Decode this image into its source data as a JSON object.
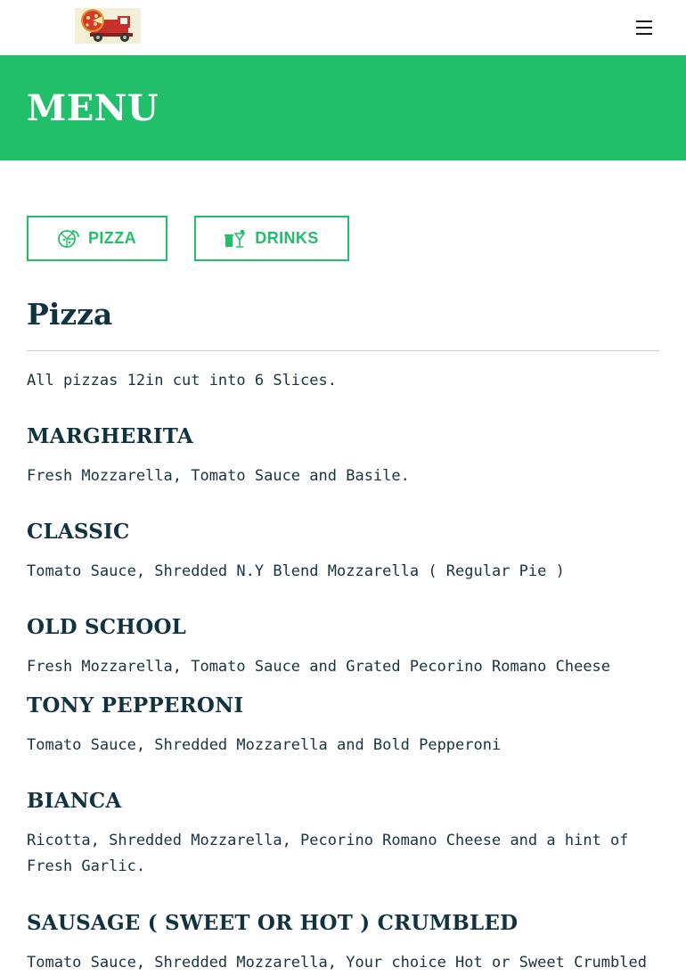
{
  "header": {
    "logo_alt": "pizza truck logo",
    "menu_icon": "hamburger-menu-icon"
  },
  "hero": {
    "title": "MENU"
  },
  "tabs": [
    {
      "label": "PIZZA",
      "icon": "pizza-slice-icon"
    },
    {
      "label": "DRINKS",
      "icon": "drinks-icon"
    }
  ],
  "section": {
    "title": "Pizza",
    "note": "All pizzas 12in cut into 6 Slices.",
    "items": [
      {
        "name": "MARGHERITA",
        "description": "Fresh Mozzarella, Tomato Sauce and Basile."
      },
      {
        "name": "CLASSIC",
        "description": "Tomato Sauce, Shredded N.Y Blend Mozzarella ( Regular Pie )"
      },
      {
        "name": "OLD SCHOOL",
        "description": "Fresh Mozzarella, Tomato Sauce and Grated Pecorino Romano Cheese"
      },
      {
        "name": "TONY PEPPERONI",
        "description": "Tomato Sauce, Shredded Mozzarella and Bold Pepperoni"
      },
      {
        "name": "BIANCA",
        "description": "Ricotta, Shredded Mozzarella, Pecorino Romano Cheese and a hint of Fresh Garlic."
      },
      {
        "name": "SAUSAGE  ( SWEET OR HOT ) CRUMBLED",
        "description": "Tomato Sauce, Shredded Mozzarella, Your choice Hot or Sweet Crumbled"
      }
    ]
  },
  "colors": {
    "brand_green": "#22bf6a",
    "heading_dark": "#113340",
    "text": "#1a3340",
    "divider": "#cfcfcf"
  }
}
